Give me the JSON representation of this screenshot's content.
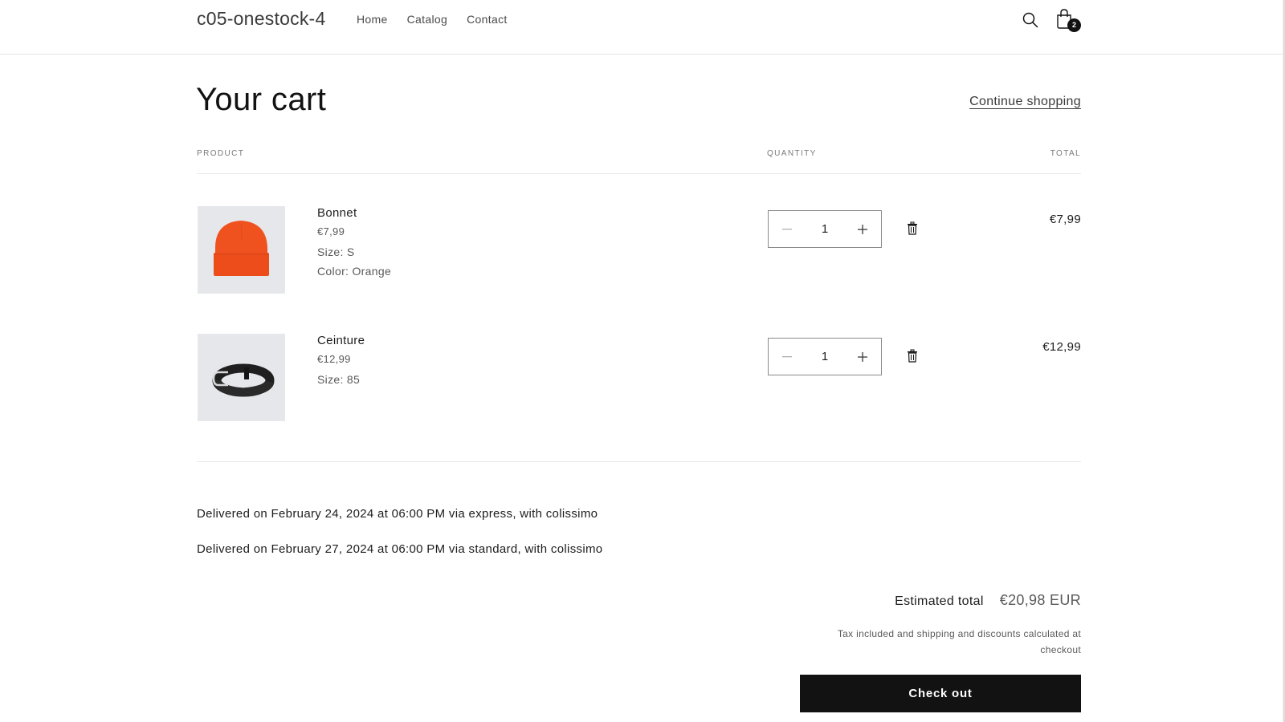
{
  "header": {
    "store_name": "c05-onestock-4",
    "nav": [
      {
        "label": "Home"
      },
      {
        "label": "Catalog"
      },
      {
        "label": "Contact"
      }
    ],
    "search_icon": "search-icon",
    "cart_icon": "shopping-bag-icon",
    "cart_count": "2"
  },
  "page": {
    "title": "Your cart",
    "continue_shopping": "Continue shopping"
  },
  "table": {
    "headers": {
      "product": "PRODUCT",
      "quantity": "QUANTITY",
      "total": "TOTAL"
    }
  },
  "items": [
    {
      "name": "Bonnet",
      "price": "€7,99",
      "options": [
        "Size: S",
        "Color: Orange"
      ],
      "quantity": "1",
      "line_total": "€7,99",
      "image": "orange-beanie"
    },
    {
      "name": "Ceinture",
      "price": "€12,99",
      "options": [
        "Size: 85"
      ],
      "quantity": "1",
      "line_total": "€12,99",
      "image": "black-belt"
    }
  ],
  "delivery": [
    "Delivered on February 24, 2024 at 06:00 PM via express, with colissimo",
    "Delivered on February 27, 2024 at 06:00 PM via standard, with colissimo"
  ],
  "summary": {
    "estimated_label": "Estimated total",
    "estimated_value": "€20,98 EUR",
    "tax_note": "Tax included and shipping and discounts calculated at checkout",
    "checkout_label": "Check out"
  },
  "colors": {
    "text": "#121212",
    "button_bg": "#121212",
    "thumb_bg": "#e5e7ea",
    "beanie": "#f0501c"
  }
}
